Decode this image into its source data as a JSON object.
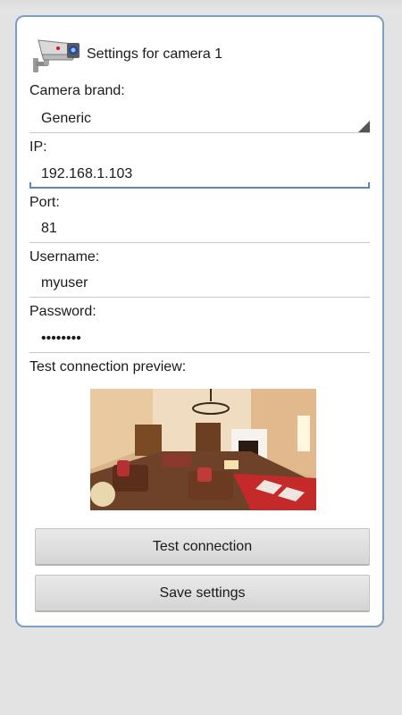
{
  "dialog": {
    "title": "Settings for camera 1",
    "header_icon": "security-camera-icon"
  },
  "form": {
    "camera_brand": {
      "label": "Camera brand:",
      "value": "Generic"
    },
    "ip": {
      "label": "IP:",
      "value": "192.168.1.103"
    },
    "port": {
      "label": "Port:",
      "value": "81"
    },
    "username": {
      "label": "Username:",
      "value": "myuser"
    },
    "password": {
      "label": "Password:",
      "value": "••••••••"
    }
  },
  "preview": {
    "label": "Test connection preview:"
  },
  "buttons": {
    "test_connection": "Test connection",
    "save_settings": "Save settings"
  },
  "colors": {
    "dialog_border": "#7a9fcb",
    "focus_underline": "#5e87b8",
    "background": "#e3e3e3"
  }
}
